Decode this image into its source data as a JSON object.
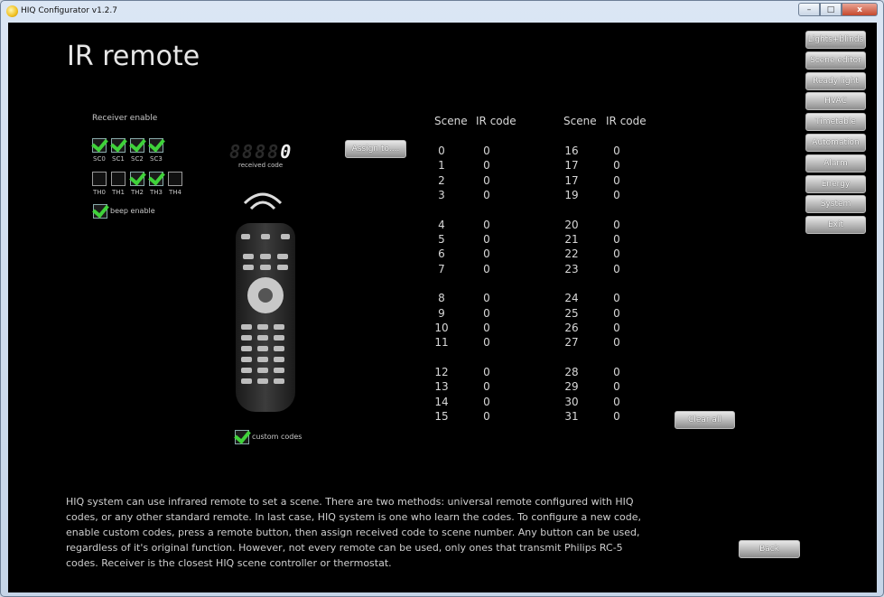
{
  "window": {
    "title": "HIQ Configurator v1.2.7",
    "minimize": "–",
    "maximize": "□",
    "close": "x"
  },
  "page": {
    "title": "IR remote"
  },
  "receiver": {
    "label": "Receiver enable",
    "row1": [
      {
        "label": "SC0",
        "checked": true
      },
      {
        "label": "SC1",
        "checked": true
      },
      {
        "label": "SC2",
        "checked": true
      },
      {
        "label": "SC3",
        "checked": true
      }
    ],
    "row2": [
      {
        "label": "TH0",
        "checked": false
      },
      {
        "label": "TH1",
        "checked": false
      },
      {
        "label": "TH2",
        "checked": true
      },
      {
        "label": "TH3",
        "checked": true
      },
      {
        "label": "TH4",
        "checked": false
      }
    ],
    "beep_label": "beep enable",
    "beep_checked": true
  },
  "display": {
    "digits": [
      "8",
      "8",
      "8",
      "8",
      "0"
    ],
    "lit_index": 4,
    "caption": "received code"
  },
  "assign_button": "Assign to....",
  "custom_codes": {
    "label": "custom codes",
    "checked": true
  },
  "table": {
    "headers": [
      "Scene",
      "IR code",
      "Scene",
      "IR code"
    ],
    "left_scenes": [
      "0",
      "1",
      "2",
      "3",
      "4",
      "5",
      "6",
      "7",
      "8",
      "9",
      "10",
      "11",
      "12",
      "13",
      "14",
      "15"
    ],
    "left_codes": [
      "0",
      "0",
      "0",
      "0",
      "0",
      "0",
      "0",
      "0",
      "0",
      "0",
      "0",
      "0",
      "0",
      "0",
      "0",
      "0"
    ],
    "right_scenes": [
      "16",
      "17",
      "17",
      "19",
      "20",
      "21",
      "22",
      "23",
      "24",
      "25",
      "26",
      "27",
      "28",
      "29",
      "30",
      "31"
    ],
    "right_codes": [
      "0",
      "0",
      "0",
      "0",
      "0",
      "0",
      "0",
      "0",
      "0",
      "0",
      "0",
      "0",
      "0",
      "0",
      "0",
      "0"
    ]
  },
  "clear_all": "Clear all",
  "back": "Back",
  "nav": [
    "Lights+blinds",
    "Scene editor",
    "Ready light",
    "HVAC",
    "Timetable",
    "Automation",
    "Alarm",
    "Energy",
    "System",
    "Exit"
  ],
  "description": "HIQ system can use infrared remote to set a scene. There are two methods: universal remote configured with HIQ codes, or any other standard remote. In last case, HIQ system is one who learn the codes. To configure a new code, enable custom codes, press a remote button, then assign received code to scene number. Any button can be used, regardless of it's original function. However, not every remote can be used, only ones that transmit Philips RC-5 codes. Receiver is the closest HIQ scene controller or thermostat."
}
